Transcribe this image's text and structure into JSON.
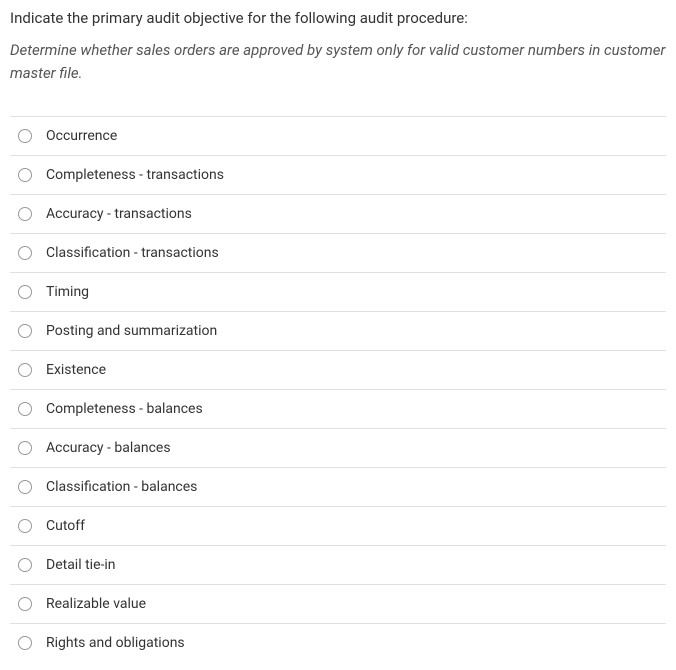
{
  "question": {
    "stem": "Indicate the primary audit objective for the following audit procedure:",
    "procedure": "Determine whether sales orders are approved by system only for valid customer numbers in customer master file."
  },
  "options": [
    {
      "label": "Occurrence"
    },
    {
      "label": "Completeness - transactions"
    },
    {
      "label": "Accuracy - transactions"
    },
    {
      "label": "Classification - transactions"
    },
    {
      "label": "Timing"
    },
    {
      "label": "Posting and summarization"
    },
    {
      "label": "Existence"
    },
    {
      "label": "Completeness - balances"
    },
    {
      "label": "Accuracy - balances"
    },
    {
      "label": "Classification - balances"
    },
    {
      "label": "Cutoff"
    },
    {
      "label": "Detail tie-in"
    },
    {
      "label": "Realizable value"
    },
    {
      "label": "Rights and obligations"
    }
  ]
}
